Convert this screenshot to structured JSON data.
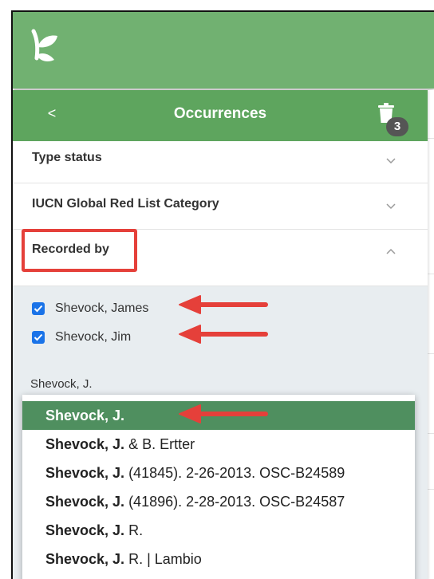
{
  "panel": {
    "back_label": "<",
    "title": "Occurrences",
    "badge_count": "3"
  },
  "filters": [
    {
      "label": "Type status",
      "expanded": false
    },
    {
      "label": "IUCN Global Red List Category",
      "expanded": false
    },
    {
      "label": "Recorded by",
      "expanded": true
    }
  ],
  "recorded_by": {
    "selected": [
      {
        "label": "Shevock, James",
        "checked": true
      },
      {
        "label": "Shevock, Jim",
        "checked": true
      }
    ],
    "search_value": "Shevock, J.",
    "suggestions": [
      {
        "match": "Shevock, J.",
        "rest": ""
      },
      {
        "match": "Shevock, J.",
        "rest": " & B. Ertter"
      },
      {
        "match": "Shevock, J.",
        "rest": " (41845). 2-26-2013. OSC-B24589"
      },
      {
        "match": "Shevock, J.",
        "rest": " (41896). 2-28-2013. OSC-B24587"
      },
      {
        "match": "Shevock, J.",
        "rest": " R."
      },
      {
        "match": "Shevock, J.",
        "rest": " R. | Lambio"
      }
    ]
  },
  "colors": {
    "app_header": "#71b171",
    "panel_header": "#5ea55e",
    "active_suggestion": "#4f8f5f",
    "annotation_red": "#e5403a",
    "checkbox_blue": "#1a73e8"
  }
}
